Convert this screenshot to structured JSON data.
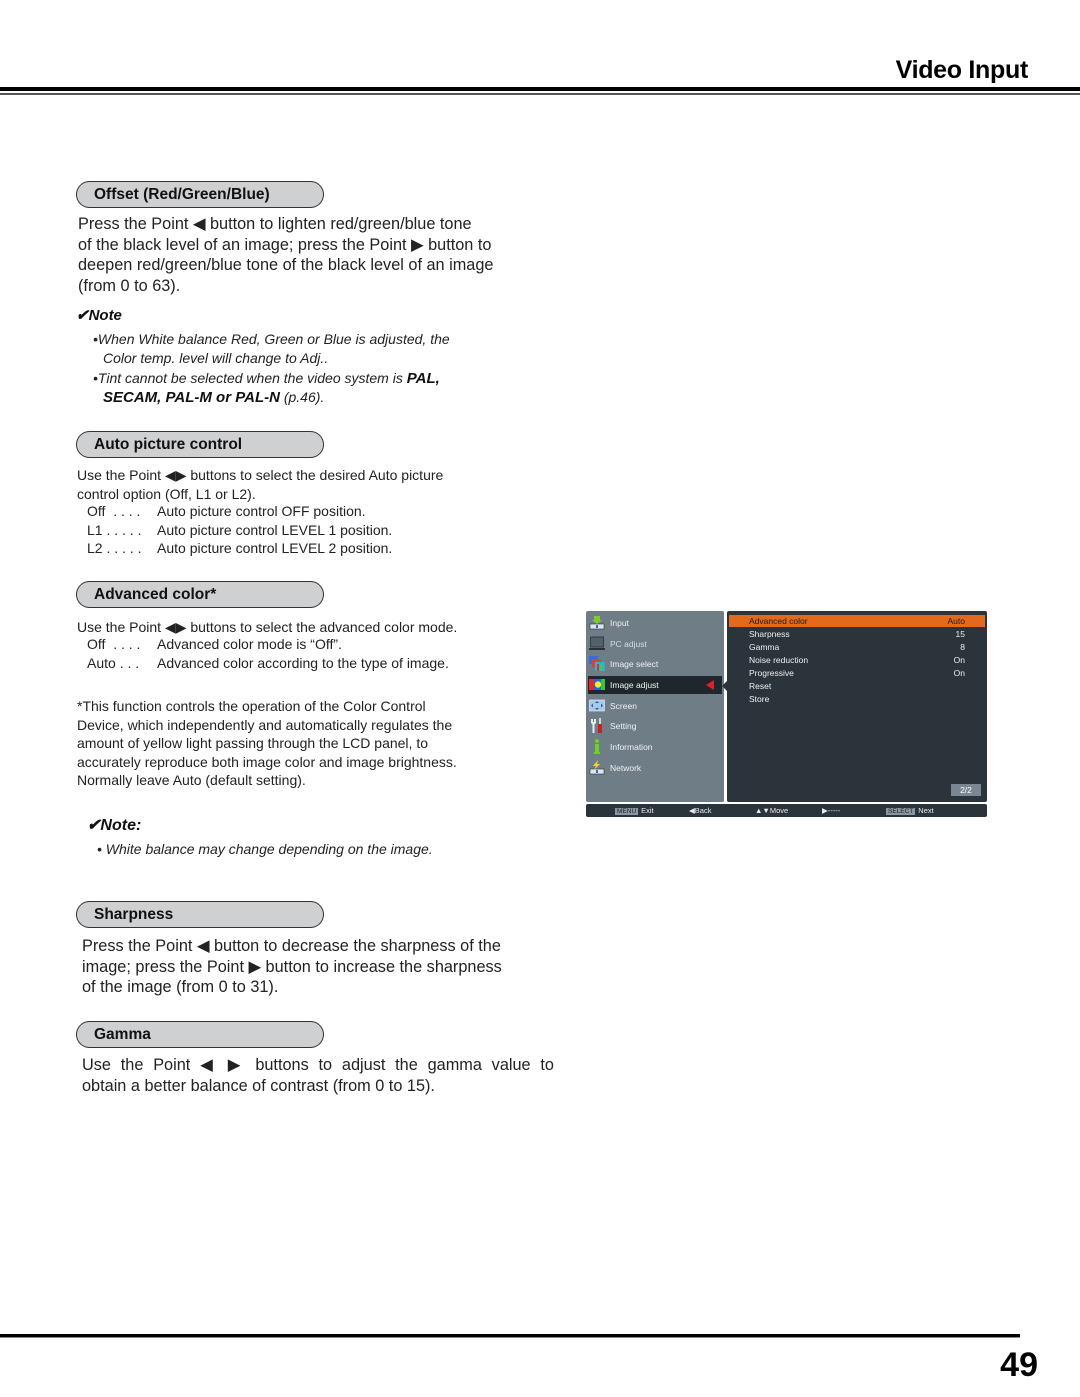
{
  "header": {
    "title": "Video Input"
  },
  "footer": {
    "page_number": "49"
  },
  "sections": {
    "offset": {
      "heading": "Offset (Red/Green/Blue)",
      "body": [
        "Press the Point ◀ button to lighten red/green/blue tone",
        "of the black level of an image; press the Point ▶ button to",
        "deepen red/green/blue tone of the black level of an image",
        "(from 0 to 63)."
      ],
      "note_label": "✔Note",
      "notes": {
        "n1_line1": "•When White balance Red, Green or Blue is adjusted, the",
        "n1_line2": "Color temp. level will change to Adj..",
        "n2_line1_pre": "•Tint cannot be selected when the video system is ",
        "n2_line1_bold": "PAL,",
        "n2_line2_bold1": "SECAM, PAL-M",
        "n2_line2_mid": " or ",
        "n2_line2_bold2": "PAL-N",
        "n2_line2_post": " (p.46)."
      }
    },
    "auto_picture": {
      "heading": "Auto picture control",
      "body": [
        "Use the Point ◀▶ buttons to select the desired Auto picture",
        "control option (Off, L1 or L2)."
      ],
      "options": [
        {
          "key": "Off  . . . .",
          "desc": "Auto picture control OFF position."
        },
        {
          "key": "L1 . . . . .",
          "desc": "Auto picture control LEVEL 1 position."
        },
        {
          "key": "L2 . . . . .",
          "desc": "Auto picture control LEVEL 2 position."
        }
      ]
    },
    "advanced_color": {
      "heading": "Advanced color*",
      "body": "Use the Point ◀▶ buttons to select the advanced color mode.",
      "options": [
        {
          "key": "Off  . . . .",
          "desc": "Advanced color mode is “Off”."
        },
        {
          "key": "Auto . . .",
          "desc": "Advanced color according to the type of image."
        }
      ],
      "footnote": [
        "*This function controls the operation of the Color Control",
        "Device, which independently and automatically regulates the",
        "amount of yellow light passing through the LCD panel, to",
        "accurately reproduce both image color and image brightness.",
        "Normally leave Auto (default setting)."
      ],
      "note_label": "✔Note:",
      "note": "• White balance may change depending on the image."
    },
    "sharpness": {
      "heading": "Sharpness",
      "body": [
        "Press the Point ◀ button to decrease the sharpness of the",
        "image; press the Point ▶ button to increase the sharpness",
        "of the image (from 0 to 31)."
      ]
    },
    "gamma": {
      "heading": "Gamma",
      "body": [
        "Use the Point ◀ ▶ buttons to adjust the gamma value to",
        "obtain a better balance of contrast (from 0 to 15)."
      ]
    }
  },
  "osd": {
    "menu": [
      {
        "label": "Input",
        "icon": "input-icon"
      },
      {
        "label": "PC adjust",
        "icon": "pc-adjust-icon"
      },
      {
        "label": "Image select",
        "icon": "image-select-icon"
      },
      {
        "label": "Image adjust",
        "icon": "image-adjust-icon",
        "active": true
      },
      {
        "label": "Screen",
        "icon": "screen-icon"
      },
      {
        "label": "Setting",
        "icon": "setting-icon"
      },
      {
        "label": "Information",
        "icon": "information-icon"
      },
      {
        "label": "Network",
        "icon": "network-icon"
      }
    ],
    "settings": [
      {
        "name": "Advanced color",
        "value": "Auto",
        "highlighted": true
      },
      {
        "name": "Sharpness",
        "value": "15"
      },
      {
        "name": "Gamma",
        "value": "8"
      },
      {
        "name": "Noise reduction",
        "value": "On"
      },
      {
        "name": "Progressive",
        "value": "On"
      },
      {
        "name": "Reset",
        "value": ""
      },
      {
        "name": "Store",
        "value": ""
      }
    ],
    "page_indicator": "2/2",
    "bottom_bar": {
      "exit_tag": "MENU",
      "exit": "Exit",
      "back": "◀Back",
      "move": "▲▼Move",
      "next_arrow": "▶-----",
      "select_tag": "SELECT",
      "next": "Next"
    },
    "colors": {
      "panel_left": "#6f7d87",
      "panel_right": "#2b343a",
      "highlight": "#e36a1c",
      "arrow": "#e0202a"
    }
  }
}
